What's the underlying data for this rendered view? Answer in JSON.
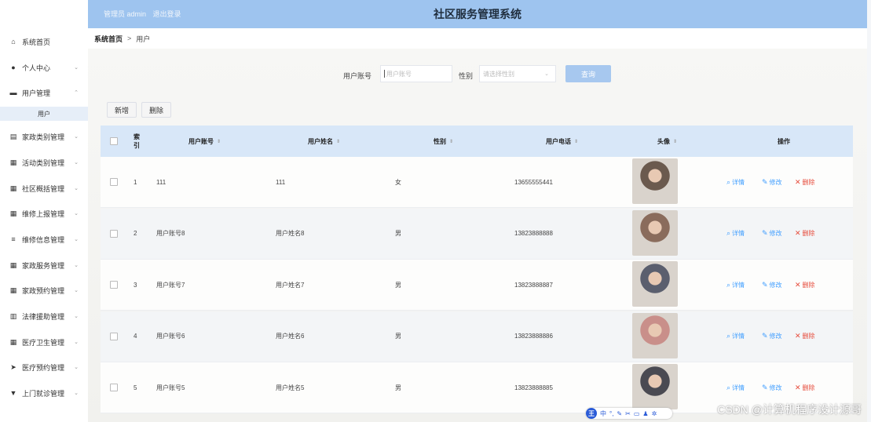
{
  "app": {
    "title": "社区服务管理系统"
  },
  "topbar": {
    "admin_text": "管理员 admin",
    "logout": "退出登录"
  },
  "sidebar": {
    "items": [
      {
        "label": "系统首页",
        "icon": "home-icon",
        "glyph": "⌂"
      },
      {
        "label": "个人中心",
        "icon": "user-icon",
        "glyph": "●"
      },
      {
        "label": "用户管理",
        "icon": "briefcase-icon",
        "glyph": "▬"
      },
      {
        "label": "家政类别管理",
        "icon": "clipboard-icon",
        "glyph": "▤"
      },
      {
        "label": "活动类别管理",
        "icon": "grid-icon",
        "glyph": "▦"
      },
      {
        "label": "社区概括管理",
        "icon": "grid-icon",
        "glyph": "▦"
      },
      {
        "label": "维修上报管理",
        "icon": "table-icon",
        "glyph": "▦"
      },
      {
        "label": "维修信息管理",
        "icon": "sliders-icon",
        "glyph": "≡"
      },
      {
        "label": "家政服务管理",
        "icon": "grid-icon",
        "glyph": "▦"
      },
      {
        "label": "家政预约管理",
        "icon": "grid-icon",
        "glyph": "▦"
      },
      {
        "label": "法律援助管理",
        "icon": "book-icon",
        "glyph": "▥"
      },
      {
        "label": "医疗卫生管理",
        "icon": "grid-icon",
        "glyph": "▦"
      },
      {
        "label": "医疗预约管理",
        "icon": "send-icon",
        "glyph": "➤"
      },
      {
        "label": "上门就诊管理",
        "icon": "trophy-icon",
        "glyph": "▼"
      }
    ],
    "sub_item": "用户"
  },
  "breadcrumb": {
    "home": "系统首页",
    "separator": ">",
    "current": "用户"
  },
  "search": {
    "account_label": "用户账号",
    "account_placeholder": "用户账号",
    "gender_label": "性别",
    "gender_placeholder": "请选择性别",
    "query_button": "查询"
  },
  "actions": {
    "add": "新增",
    "delete": "删除"
  },
  "table": {
    "headers": {
      "index": "索引",
      "account": "用户账号",
      "name": "用户姓名",
      "gender": "性别",
      "phone": "用户电话",
      "avatar": "头像",
      "ops": "操作"
    },
    "rows": [
      {
        "index": "1",
        "account": "111",
        "name": "111",
        "gender": "女",
        "phone": "13655555441",
        "avatar_color": "#6b5a4e"
      },
      {
        "index": "2",
        "account": "用户账号8",
        "name": "用户姓名8",
        "gender": "男",
        "phone": "13823888888",
        "avatar_color": "#8a6c5c"
      },
      {
        "index": "3",
        "account": "用户账号7",
        "name": "用户姓名7",
        "gender": "男",
        "phone": "13823888887",
        "avatar_color": "#5b5f6e"
      },
      {
        "index": "4",
        "account": "用户账号6",
        "name": "用户姓名6",
        "gender": "男",
        "phone": "13823888886",
        "avatar_color": "#c98f8a"
      },
      {
        "index": "5",
        "account": "用户账号5",
        "name": "用户姓名5",
        "gender": "男",
        "phone": "13823888885",
        "avatar_color": "#4a4a52"
      }
    ],
    "op_labels": {
      "detail": "详情",
      "edit": "修改",
      "delete": "删除"
    }
  },
  "watermark": "CSDN @计算机程序设计源哥",
  "colors": {
    "topbar": "#9ec4ef",
    "accent": "#409eff",
    "danger": "#e64b3b",
    "query_button": "#a7c8ef"
  }
}
